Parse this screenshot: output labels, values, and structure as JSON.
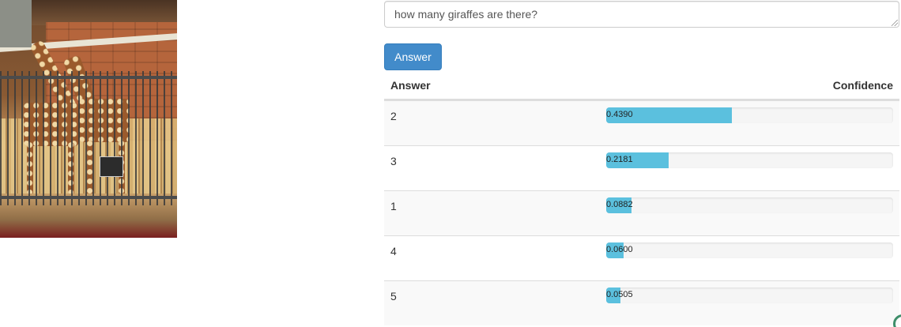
{
  "image": {
    "alt_icon": "giraffe-photo"
  },
  "question": {
    "value": "how many giraffes are there?"
  },
  "submit": {
    "label": "Answer"
  },
  "table": {
    "columns": [
      "Answer",
      "Confidence"
    ],
    "rows": [
      {
        "answer": "2",
        "confidence": "0.4390",
        "fraction": 0.439
      },
      {
        "answer": "3",
        "confidence": "0.2181",
        "fraction": 0.2181
      },
      {
        "answer": "1",
        "confidence": "0.0882",
        "fraction": 0.0882
      },
      {
        "answer": "4",
        "confidence": "0.0600",
        "fraction": 0.06
      },
      {
        "answer": "5",
        "confidence": "0.0505",
        "fraction": 0.0505
      }
    ]
  },
  "colors": {
    "button": "#428bca",
    "bar": "#5bc0de"
  }
}
